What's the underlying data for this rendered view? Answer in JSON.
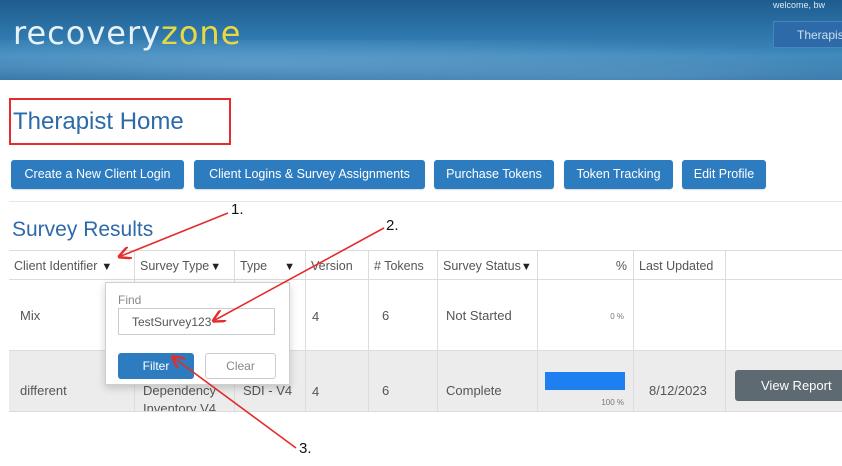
{
  "header": {
    "logo_part1": "recovery",
    "logo_part2": "zone",
    "welcome": "welcome, bw",
    "role_button": "Therapist"
  },
  "page_title": "Therapist Home",
  "actions": [
    {
      "label": "Create a New Client Login"
    },
    {
      "label": "Client Logins & Survey Assignments"
    },
    {
      "label": "Purchase Tokens"
    },
    {
      "label": "Token Tracking"
    },
    {
      "label": "Edit Profile"
    }
  ],
  "section_title": "Survey Results",
  "table": {
    "columns": [
      "Client Identifier",
      "Survey Type",
      "Type",
      "Version",
      "# Tokens",
      "Survey Status",
      "%",
      "Last Updated"
    ],
    "rows": [
      {
        "client": "Mix",
        "survey_type": "",
        "type": "",
        "version": "4",
        "tokens": "6",
        "status": "Not Started",
        "percent_label": "0 %",
        "progress": 0,
        "last_updated": "",
        "action": ""
      },
      {
        "client": "different",
        "survey_type_line1": "Dependency",
        "survey_type_line2": "Inventory V4",
        "type": "SDI - V4",
        "version": "4",
        "tokens": "6",
        "status": "Complete",
        "percent_label": "100 %",
        "progress": 100,
        "last_updated": "8/12/2023",
        "action": "View Report"
      }
    ]
  },
  "filter_popover": {
    "find_label": "Find",
    "find_value": "TestSurvey123",
    "filter_button": "Filter",
    "clear_button": "Clear"
  },
  "annotations": {
    "marker1": "1.",
    "marker2": "2.",
    "marker3": "3.",
    "color": "#e52b2b"
  },
  "colors": {
    "brand_blue": "#2d7cc0",
    "title_blue": "#2d6aa9",
    "progress": "#1e7ff0",
    "view_report_bg": "#5e6a72",
    "logo_accent": "#e9d93e"
  }
}
